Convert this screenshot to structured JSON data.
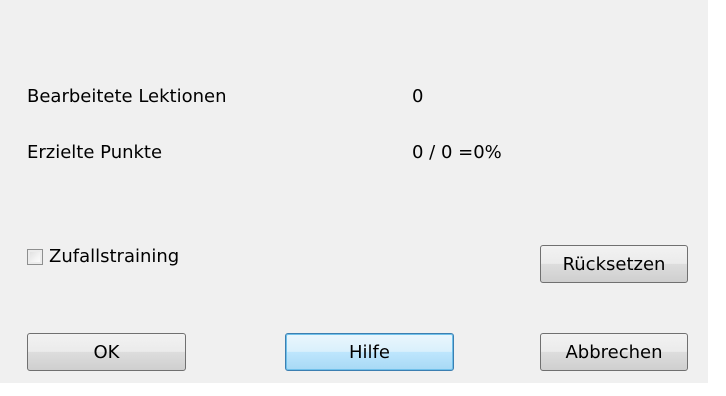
{
  "stats": {
    "lessons_label": "Bearbeitete Lektionen",
    "lessons_value": "0",
    "points_label": "Erzielte Punkte",
    "points_value": "0 / 0 =0%"
  },
  "options": {
    "random_training_label": "Zufallstraining",
    "random_training_checked": false
  },
  "buttons": {
    "reset": "Rücksetzen",
    "ok": "OK",
    "help": "Hilfe",
    "cancel": "Abbrechen"
  }
}
